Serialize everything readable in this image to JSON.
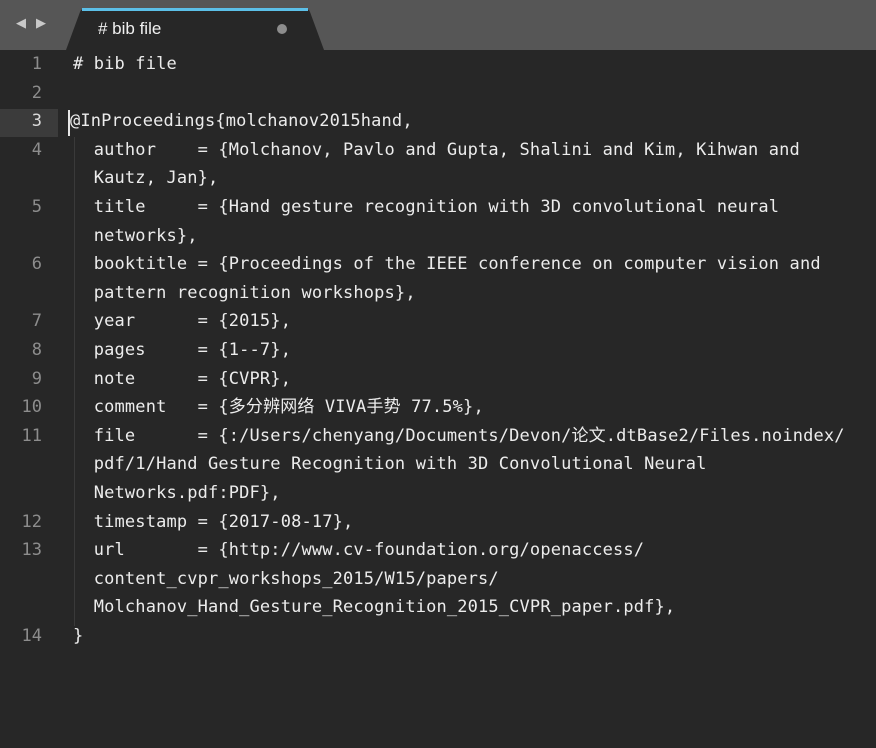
{
  "tab": {
    "title": "# bib file",
    "nav_back": "◀",
    "nav_forward": "▶"
  },
  "colors": {
    "tab_bar_bg": "#565656",
    "tab_active_bg": "#272727",
    "tab_accent": "#5cc0e8",
    "editor_bg": "#272727",
    "text": "#ececec",
    "line_number": "#8d8d8d"
  },
  "editor": {
    "line_numbers": [
      "1",
      "2",
      "3",
      "4",
      "",
      "5",
      "",
      "6",
      "",
      "7",
      "8",
      "9",
      "10",
      "11",
      "",
      "",
      "12",
      "13",
      "",
      "",
      "14"
    ],
    "lines": [
      "# bib file",
      "",
      "@InProceedings{molchanov2015hand,",
      "  author    = {Molchanov, Pavlo and Gupta, Shalini and Kim, Kihwan and",
      "  Kautz, Jan},",
      "  title     = {Hand gesture recognition with 3D convolutional neural",
      "  networks},",
      "  booktitle = {Proceedings of the IEEE conference on computer vision and",
      "  pattern recognition workshops},",
      "  year      = {2015},",
      "  pages     = {1--7},",
      "  note      = {CVPR},",
      "  comment   = {多分辨网络 VIVA手势 77.5%},",
      "  file      = {:/Users/chenyang/Documents/Devon/论文.dtBase2/Files.noindex/",
      "  pdf/1/Hand Gesture Recognition with 3D Convolutional Neural",
      "  Networks.pdf:PDF},",
      "  timestamp = {2017-08-17},",
      "  url       = {http://www.cv-foundation.org/openaccess/",
      "  content_cvpr_workshops_2015/W15/papers/",
      "  Molchanov_Hand_Gesture_Recognition_2015_CVPR_paper.pdf},",
      "}"
    ]
  }
}
